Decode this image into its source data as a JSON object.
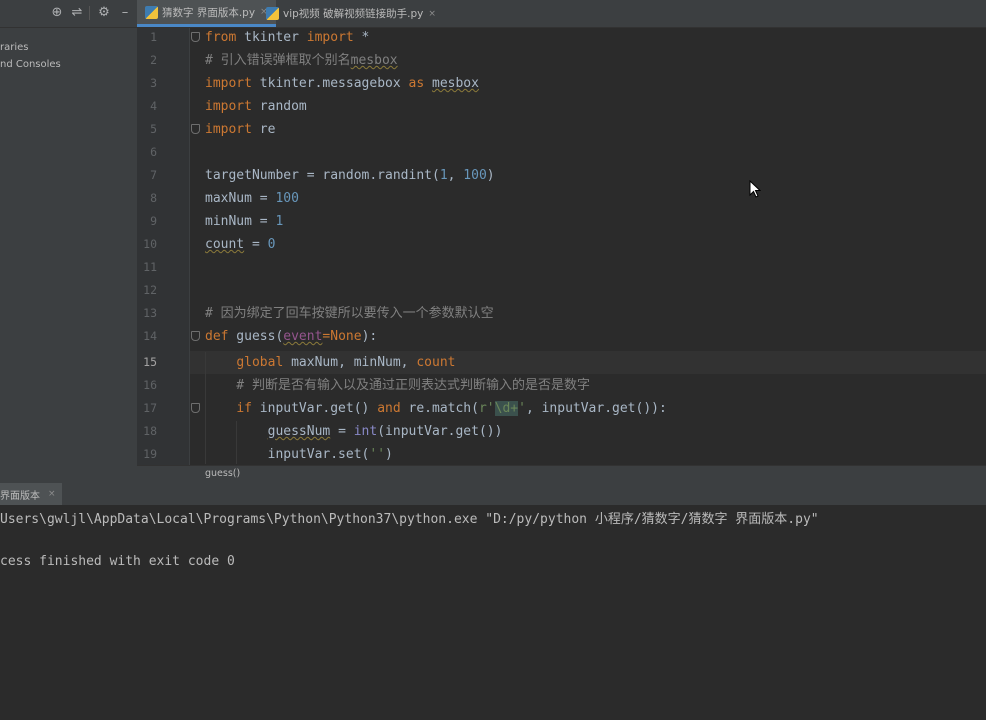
{
  "project_panel": {
    "tree_items": [
      "raries",
      "nd Consoles"
    ]
  },
  "tabs": [
    {
      "label": "猜数字 界面版本.py",
      "close": "×",
      "active": true
    },
    {
      "label": "vip视频 破解视频链接助手.py",
      "close": "×",
      "active": false
    }
  ],
  "editor": {
    "current_line": 15,
    "line_numbers": [
      "1",
      "2",
      "3",
      "4",
      "5",
      "6",
      "7",
      "8",
      "9",
      "10",
      "11",
      "12",
      "13",
      "14",
      "15",
      "16",
      "17",
      "18",
      "19"
    ],
    "breadcrumb": "guess()"
  },
  "code": {
    "l1_a": "from",
    "l1_b": " tkinter ",
    "l1_c": "import",
    "l1_d": " *",
    "l2_a": "# 引入错误弹框取个别名",
    "l2_b": "mesbox",
    "l3_a": "import",
    "l3_b": " tkinter.messagebox ",
    "l3_c": "as",
    "l3_d": " ",
    "l3_e": "mesbox",
    "l4_a": "import",
    "l4_b": " random",
    "l5_a": "import",
    "l5_b": " re",
    "l7_a": "targetNumber = random.randint(",
    "l7_b": "1",
    "l7_c": ", ",
    "l7_d": "100",
    "l7_e": ")",
    "l8_a": "maxNum = ",
    "l8_b": "100",
    "l9_a": "minNum = ",
    "l9_b": "1",
    "l10_a": "count",
    "l10_b": " = ",
    "l10_c": "0",
    "l13_a": "# 因为绑定了回车按键所以要传入一个参数默认空",
    "l14_a": "def",
    "l14_b": " guess(",
    "l14_c": "event",
    "l14_d": "=",
    "l14_e": "None",
    "l14_f": "):",
    "l15_a": "    ",
    "l15_b": "global",
    "l15_c": " maxNum, minNum, ",
    "l15_d": "count",
    "l16_a": "    # 判断是否有输入以及通过正则表达式判断输入的是否是数字",
    "l17_a": "    ",
    "l17_b": "if",
    "l17_c": " inputVar.get() ",
    "l17_d": "and",
    "l17_e": " re.match(",
    "l17_f": "r'",
    "l17_g": "\\d+",
    "l17_h": "'",
    "l17_i": ", inputVar.get()):",
    "l18_a": "        ",
    "l18_b": "guessNum",
    "l18_c": " = ",
    "l18_d": "int",
    "l18_e": "(inputVar.get())",
    "l19_a": "        inputVar.set(",
    "l19_b": "''",
    "l19_c": ")"
  },
  "run_panel": {
    "tab_label": "界面版本",
    "tab_close": "×",
    "console_lines": [
      "Users\\gwljl\\AppData\\Local\\Programs\\Python\\Python37\\python.exe \"D:/py/python 小程序/猜数字/猜数字 界面版本.py\"",
      "cess finished with exit code 0"
    ]
  },
  "colors": {
    "background": "#2b2b2b",
    "keyword": "#cc7832",
    "comment": "#808080",
    "number": "#6897bb",
    "string": "#6a8759",
    "text": "#a9b7c6"
  },
  "icons": [
    "target-icon",
    "collapse-icon",
    "gear-icon",
    "minimize-icon",
    "python-file-icon",
    "close-icon",
    "mouse-pointer-icon"
  ]
}
